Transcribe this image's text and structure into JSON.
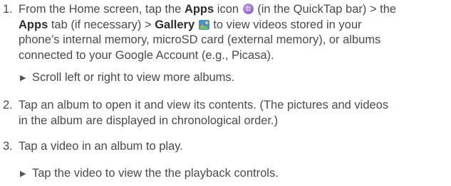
{
  "steps": [
    {
      "number": "1.",
      "lines": {
        "l1_a": "From the Home screen, tap the ",
        "l1_apps": "Apps",
        "l1_b": " icon ",
        "l1_c": " (in the QuickTap bar) > the",
        "l2_apps": "Apps",
        "l2_b": " tab (if necessary) > ",
        "l2_gallery": "Gallery",
        "l2_c": " to view videos stored in your",
        "l3": "phone’s internal memory, microSD card (external memory), or albums",
        "l4": "connected to your Google Account (e.g., Picasa)."
      },
      "icons": {
        "apps_icon": "apps-icon",
        "gallery_icon": "gallery-icon"
      },
      "bullet": "Scroll left or right to view more albums."
    },
    {
      "number": "2.",
      "lines": {
        "l1": "Tap an album to open it and view its contents. (The pictures and videos",
        "l2": "in the album are displayed in chronological order.)"
      }
    },
    {
      "number": "3.",
      "lines": {
        "l1": "Tap a video in an album to play."
      },
      "bullet": "Tap the video to view the the playback controls."
    }
  ],
  "bullet_marker": "▶",
  "colors": {
    "text": "#4a4a4a",
    "bold_text": "#2e2e2e",
    "apps_icon": "#9b6cc9",
    "gallery_icon": "#4a90c2"
  }
}
